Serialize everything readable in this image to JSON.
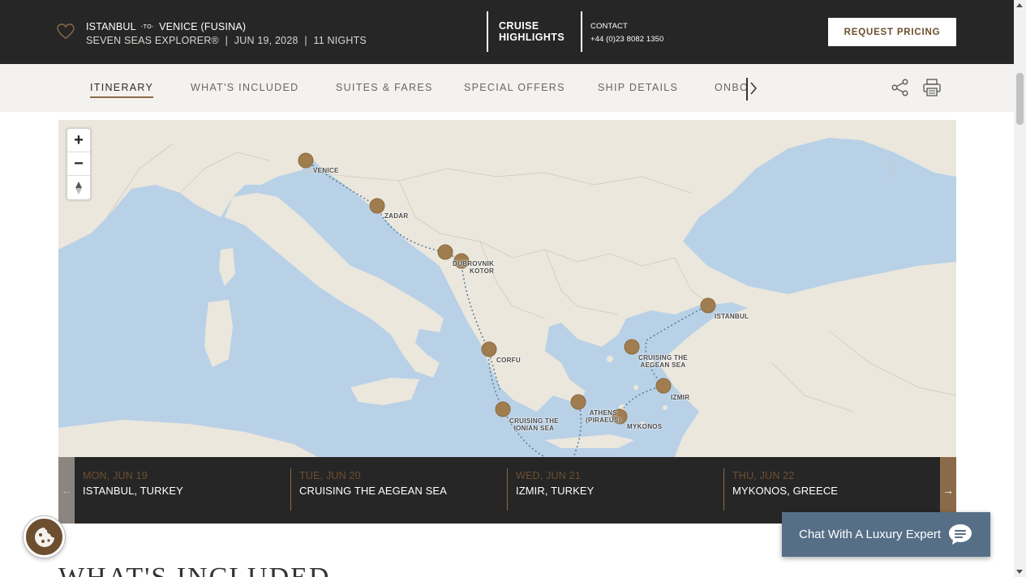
{
  "header": {
    "origin": "ISTANBUL",
    "to_word": "-TO-",
    "destination": "VENICE (FUSINA)",
    "ship": "SEVEN SEAS EXPLORER®",
    "date": "JUN 19, 2028",
    "nights": "11 NIGHTS",
    "highlights_line1": "CRUISE",
    "highlights_line2": "HIGHLIGHTS",
    "contact_label": "CONTACT",
    "contact_phone": "+44 (0)23 8082 1350",
    "request_button": "REQUEST PRICING",
    "separator": "|"
  },
  "nav": {
    "tabs": [
      "ITINERARY",
      "WHAT'S INCLUDED",
      "SUITES & FARES",
      "SPECIAL OFFERS",
      "SHIP DETAILS",
      "ONBOARD"
    ],
    "active_tab": "ITINERARY",
    "icons": [
      "share-icon",
      "print-icon",
      "chevron-right-icon"
    ]
  },
  "map": {
    "controls": {
      "zoom_in": "+",
      "zoom_out": "−",
      "compass": "▲"
    },
    "ports": {
      "venice": "VENICE",
      "zadar": "ZADAR",
      "dubrovnik": "DUBROVNIK",
      "kotor": "KOTOR",
      "corfu": "CORFU",
      "ionian_line1": "CRUISING THE",
      "ionian_line2": "IONIAN SEA",
      "athens_line1": "ATHENS",
      "athens_line2": "(PIRAEUS)",
      "mykonos": "MYKONOS",
      "izmir": "IZMIR",
      "aegean_line1": "CRUISING THE",
      "aegean_line2": "AEGEAN SEA",
      "istanbul": "ISTANBUL"
    },
    "colors": {
      "water": "#b9d1e6",
      "land": "#ebe7dd",
      "marker": "#a07d4f",
      "route": "#5a7a95"
    }
  },
  "days": [
    {
      "date": "MON, JUN 19",
      "port": "ISTANBUL, TURKEY"
    },
    {
      "date": "TUE, JUN 20",
      "port": "CRUISING THE AEGEAN SEA"
    },
    {
      "date": "WED, JUN 21",
      "port": "IZMIR, TURKEY"
    },
    {
      "date": "THU, JUN 22",
      "port": "MYKONOS, GREECE"
    }
  ],
  "days_nav": {
    "prev": "←",
    "next": "→"
  },
  "section_title": "WHAT'S INCLUDED",
  "chat": {
    "label": "Chat With A Luxury Expert"
  }
}
